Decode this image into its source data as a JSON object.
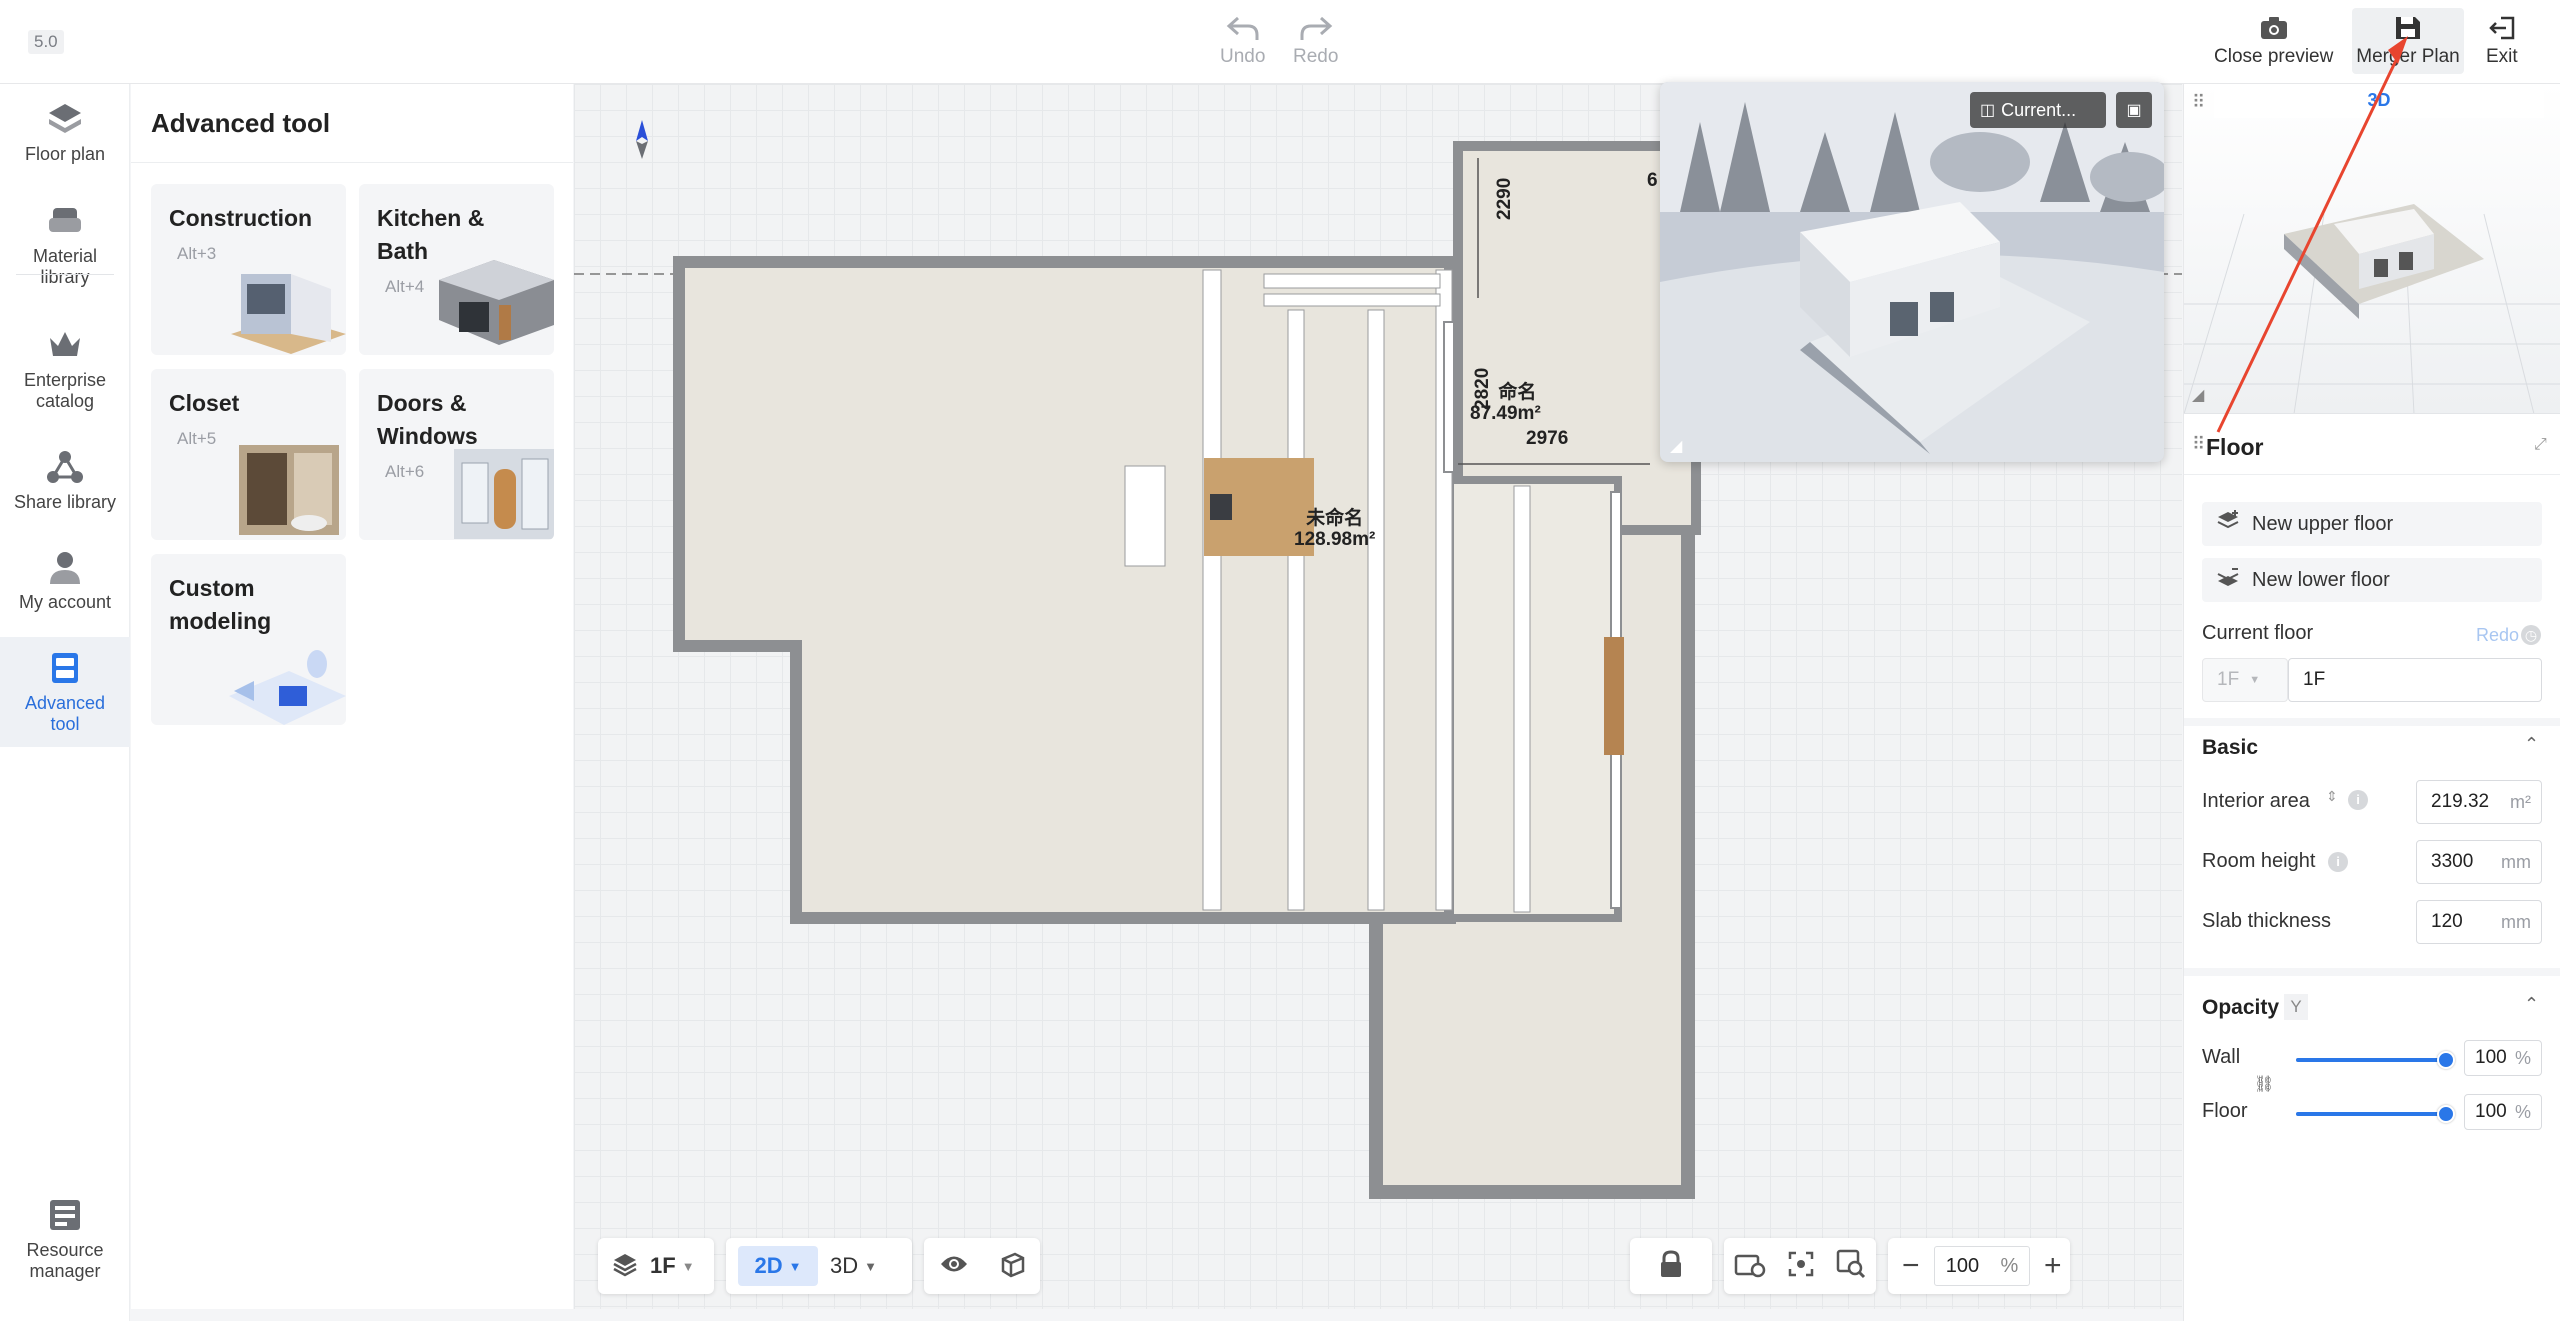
{
  "app": {
    "version": "5.0"
  },
  "toolbar": {
    "undo": "Undo",
    "redo": "Redo",
    "close_preview": "Close preview",
    "merger_plan": "Merger Plan",
    "exit": "Exit"
  },
  "nav": {
    "items": [
      {
        "label": "Floor plan",
        "icon": "floor-plan-icon"
      },
      {
        "label": "Material library",
        "icon": "sofa-icon"
      },
      {
        "label": "Enterprise catalog",
        "icon": "crown-icon"
      },
      {
        "label": "Share library",
        "icon": "share-icon"
      },
      {
        "label": "My account",
        "icon": "user-icon"
      },
      {
        "label": "Advanced tool",
        "icon": "cabinet-icon",
        "active": true
      }
    ],
    "resource_manager": "Resource manager"
  },
  "advanced_tool": {
    "title": "Advanced tool",
    "cards": [
      {
        "title": "Construction",
        "shortcut": "Alt+3"
      },
      {
        "title": "Kitchen & Bath",
        "shortcut": "Alt+4"
      },
      {
        "title": "Closet",
        "shortcut": "Alt+5"
      },
      {
        "title": "Doors & Windows",
        "shortcut": "Alt+6"
      },
      {
        "title": "Custom modeling",
        "shortcut": ""
      }
    ]
  },
  "plan": {
    "room1_name": "未命名",
    "room1_area": "128.98m²",
    "room2_name": "命名",
    "room2_area": "87.49m²",
    "dim_2290": "2290",
    "dim_2820": "2820",
    "dim_2976": "2976",
    "dim_partial": "6"
  },
  "bottom": {
    "floor": "1F",
    "mode_2d": "2D",
    "mode_3d": "3D",
    "zoom": "100",
    "zoom_unit": "%"
  },
  "preview": {
    "camera_label": "Current..."
  },
  "right": {
    "view_tab": "3D",
    "floor_title": "Floor",
    "new_upper": "New upper floor",
    "new_lower": "New lower floor",
    "current_floor_label": "Current floor",
    "current_floor_redo": "Redo",
    "floor_select": "1F",
    "floor_name": "1F",
    "basic_title": "Basic",
    "interior_area_label": "Interior area",
    "interior_area_value": "219.32",
    "interior_area_unit": "m²",
    "room_height_label": "Room height",
    "room_height_value": "3300",
    "room_height_unit": "mm",
    "slab_label": "Slab thickness",
    "slab_value": "120",
    "slab_unit": "mm",
    "opacity_title": "Opacity",
    "opacity_key": "Y",
    "wall_label": "Wall",
    "wall_value": "100",
    "wall_level": 1.0,
    "floor_label": "Floor",
    "floor_value": "100",
    "floor_level": 1.0,
    "percent": "%"
  },
  "colors": {
    "accent": "#2a77e8",
    "arrow": "#e8452f",
    "wall": "#8d8f92",
    "floor_fill": "#e8e5dd"
  }
}
